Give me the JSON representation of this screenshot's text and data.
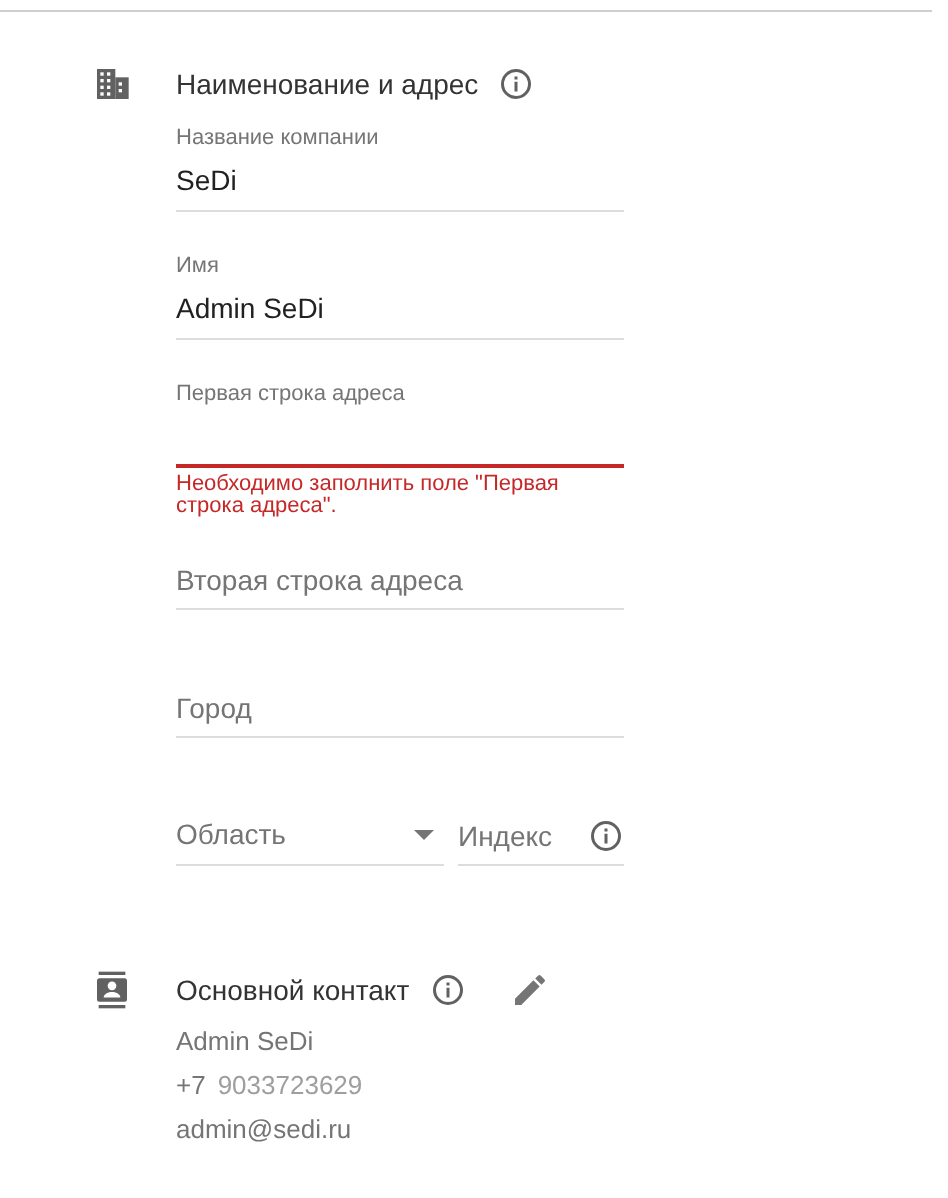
{
  "address_section": {
    "title": "Наименование и адрес",
    "info": true,
    "fields": [
      {
        "kind": "text",
        "label": "Название компании",
        "value": "SeDi"
      },
      {
        "kind": "text",
        "label": "Имя",
        "value": "Admin SeDi"
      },
      {
        "kind": "text",
        "label": "Первая строка адреса",
        "error": "Необходимо заполнить поле \"Первая строка адреса\"."
      },
      {
        "kind": "text",
        "placeholder": "Вторая строка адреса"
      },
      {
        "kind": "text",
        "placeholder": "Город"
      },
      {
        "kind": "row",
        "items": [
          {
            "kind": "select",
            "placeholder": "Область"
          },
          {
            "kind": "text",
            "placeholder": "Индекс",
            "info": true
          }
        ]
      }
    ]
  },
  "contact_section": {
    "title": "Основной контакт",
    "info": true,
    "editable": true,
    "name": "Admin SeDi",
    "phone_prefix": "+7",
    "phone": "9033723629",
    "email": "admin@sedi.ru"
  }
}
